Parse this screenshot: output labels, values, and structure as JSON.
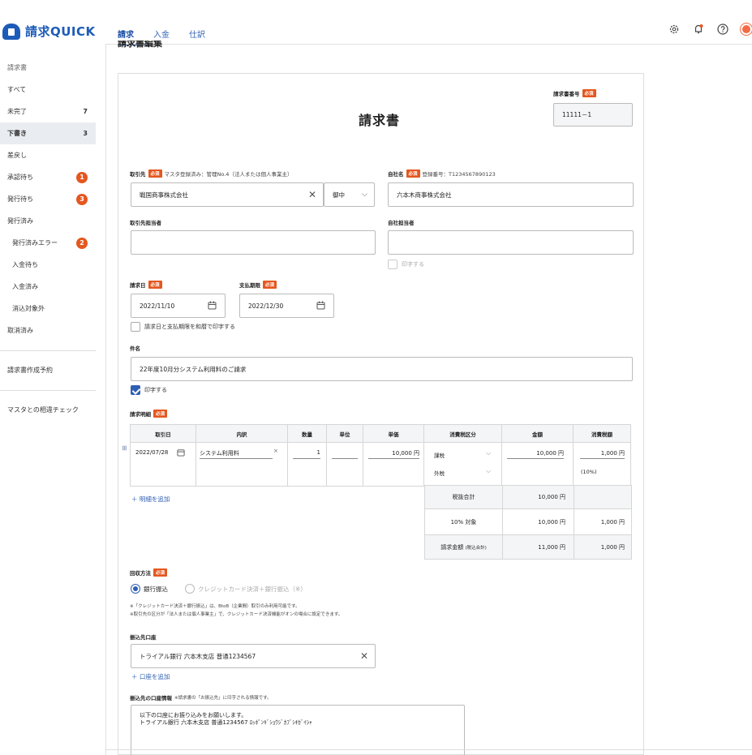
{
  "app": {
    "name": "請求QUICK"
  },
  "nav": {
    "tabs": [
      "請求",
      "入金",
      "仕訳"
    ]
  },
  "sidebar": {
    "items": [
      {
        "label": "請求書",
        "count": "",
        "badge": "",
        "kind": "head"
      },
      {
        "label": "すべて",
        "count": "",
        "badge": ""
      },
      {
        "label": "未完了",
        "count": "7",
        "badge": ""
      },
      {
        "label": "下書き",
        "count": "3",
        "badge": "",
        "active": true
      },
      {
        "label": "差戻し",
        "count": "",
        "badge": ""
      },
      {
        "label": "承認待ち",
        "count": "",
        "badge": "1"
      },
      {
        "label": "発行待ち",
        "count": "",
        "badge": "3"
      },
      {
        "label": "発行済み",
        "count": "",
        "badge": ""
      },
      {
        "label": "発行済みエラー",
        "count": "",
        "badge": "2",
        "sub": true
      },
      {
        "label": "入金待ち",
        "count": "",
        "badge": "",
        "sub": true
      },
      {
        "label": "入金済み",
        "count": "",
        "badge": "",
        "sub": true
      },
      {
        "label": "消込対象外",
        "count": "",
        "badge": "",
        "sub": true
      },
      {
        "label": "取消済み",
        "count": "",
        "badge": ""
      }
    ],
    "schedule": "請求書作成予約",
    "check": "マスタとの相違チェック"
  },
  "page": {
    "title": "請求書編集"
  },
  "form": {
    "required": "必須",
    "doc_title": "請求書",
    "invoice_no_label": "請求書番号",
    "invoice_no": "11111－1",
    "client_label": "取引先",
    "client_note": "マスタ登録済み：管理No.4（法人または個人事業主）",
    "client_value": "戦国商事株式会社",
    "honorific": "御中",
    "company_label": "自社名",
    "company_note": "登録番号：T1234567890123",
    "company_value": "六本木商事株式会社",
    "client_person_label": "取引先担当者",
    "our_person_label": "自社担当者",
    "print_label": "印字する",
    "invoice_date_label": "請求日",
    "invoice_date": "2022/11/10",
    "due_date_label": "支払期限",
    "due_date": "2022/12/30",
    "wareki_label": "請求日と支払期限を和暦で印字する",
    "subject_label": "件名",
    "subject": "22年度10月分システム利用料のご請求",
    "subject_print": "印字する",
    "detail_label": "請求明細",
    "columns": [
      "取引日",
      "内訳",
      "数量",
      "単位",
      "単価",
      "消費税区分",
      "金額",
      "消費税額"
    ],
    "row": {
      "date": "2022/07/28",
      "item": "システム利用料",
      "qty": "1",
      "unit": "",
      "price": "10,000 円",
      "tax_kind": "課税",
      "tax_type": "外税",
      "amount": "10,000 円",
      "tax": "1,000 円",
      "rate": "(10%)"
    },
    "add_detail": "＋ 明細を追加",
    "summary": [
      {
        "label": "税抜合計",
        "amount": "10,000 円",
        "tax": ""
      },
      {
        "label": "10% 対象",
        "amount": "10,000 円",
        "tax": "1,000 円"
      },
      {
        "label": "請求金額",
        "label_sub": "(税込合計)",
        "amount": "11,000 円",
        "tax": "1,000 円"
      }
    ],
    "collect_label": "回収方法",
    "collect_bank": "銀行振込",
    "collect_card": "クレジットカード決済＋銀行振込（※）",
    "note1": "※「クレジットカード決済＋銀行振込」は、BtoB（企業間）取引のみ利用可能です。",
    "note2": "※取引先の区分が「法人または個人事業主」で、クレジットカード決済機能がオンの場合に設定できます。",
    "bank_label": "振込先口座",
    "bank_value": "トライアル銀行 六本木支店 普通1234567",
    "add_bank": "＋ 口座を追加",
    "bank_info_label": "振込先の口座情報",
    "bank_info_note": "※請求書の「お振込先」に印字される情報です。",
    "bank_info_text": "以下の口座にお振り込みをお願いします。\nトライアル銀行 六本木支店 普通1234567 ﾛｯﾎﾟﾝｷﾞｼｮｳｼﾞｶﾌﾞｼｷｶﾞｲｼｬ"
  },
  "colors": {
    "accent": "#1d5bb8",
    "required": "#e4571f"
  }
}
